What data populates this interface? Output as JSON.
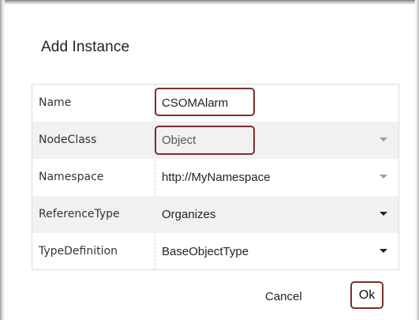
{
  "dialog": {
    "title": "Add Instance"
  },
  "form": {
    "rows": [
      {
        "label": "Name",
        "value": "CSOMAlarm",
        "control": "text-input"
      },
      {
        "label": "NodeClass",
        "value": "Object",
        "control": "dropdown-disabled"
      },
      {
        "label": "Namespace",
        "value": "http://MyNamespace",
        "control": "dropdown-disabled"
      },
      {
        "label": "ReferenceType",
        "value": "Organizes",
        "control": "dropdown"
      },
      {
        "label": "TypeDefinition",
        "value": "BaseObjectType",
        "control": "dropdown"
      }
    ]
  },
  "buttons": {
    "cancel_label": "Cancel",
    "ok_label": "Ok"
  },
  "icons": {
    "dropdown": "chevron-down-icon"
  },
  "colors": {
    "highlight": "#7b2e2e",
    "row_shade": "#f1f1f1",
    "disabled_arrow": "#9a9a9a"
  }
}
